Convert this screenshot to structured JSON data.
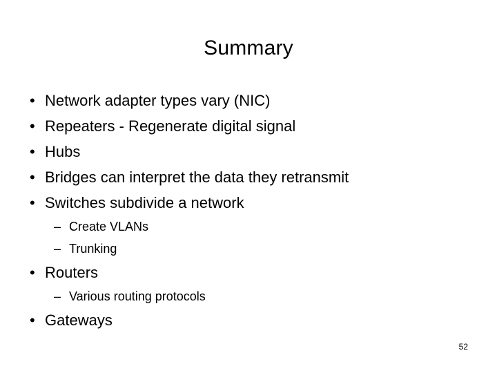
{
  "slide": {
    "title": "Summary",
    "page_number": "52",
    "background_color": "#ffffff",
    "text_color": "#000000",
    "bullets": [
      {
        "level": 1,
        "marker": "•",
        "text": "Network adapter types vary (NIC)"
      },
      {
        "level": 1,
        "marker": "•",
        "text": "Repeaters - Regenerate digital signal"
      },
      {
        "level": 1,
        "marker": "•",
        "text": "Hubs"
      },
      {
        "level": 1,
        "marker": "•",
        "text": "Bridges can interpret the data they retransmit"
      },
      {
        "level": 1,
        "marker": "•",
        "text": "Switches subdivide a network"
      },
      {
        "level": 2,
        "marker": "–",
        "text": "Create VLANs"
      },
      {
        "level": 2,
        "marker": "–",
        "text": "Trunking"
      },
      {
        "level": 1,
        "marker": "•",
        "text": "Routers"
      },
      {
        "level": 2,
        "marker": "–",
        "text": "Various routing protocols"
      },
      {
        "level": 1,
        "marker": "•",
        "text": "Gateways"
      }
    ]
  }
}
